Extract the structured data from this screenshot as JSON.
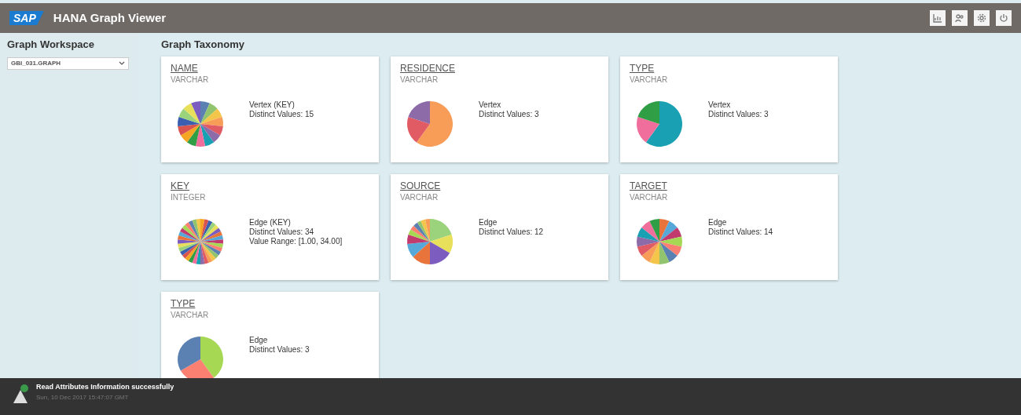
{
  "header": {
    "logo": "SAP",
    "title": "HANA Graph Viewer"
  },
  "sidebar": {
    "title": "Graph Workspace",
    "workspace_select": {
      "value": "GBI_031.GRAPH"
    }
  },
  "taxonomy": {
    "title": "Graph Taxonomy",
    "cards": [
      {
        "name": "NAME",
        "datatype": "VARCHAR",
        "lines": [
          "Vertex (KEY)",
          "Distinct Values: 15"
        ]
      },
      {
        "name": "RESIDENCE",
        "datatype": "VARCHAR",
        "lines": [
          "Vertex",
          "Distinct Values: 3"
        ]
      },
      {
        "name": "TYPE",
        "datatype": "VARCHAR",
        "lines": [
          "Vertex",
          "Distinct Values: 3"
        ]
      },
      {
        "name": "KEY",
        "datatype": "INTEGER",
        "lines": [
          "Edge (KEY)",
          "Distinct Values: 34",
          "Value Range: [1.00, 34.00]"
        ]
      },
      {
        "name": "SOURCE",
        "datatype": "VARCHAR",
        "lines": [
          "Edge",
          "Distinct Values: 12"
        ]
      },
      {
        "name": "TARGET",
        "datatype": "VARCHAR",
        "lines": [
          "Edge",
          "Distinct Values: 14"
        ]
      },
      {
        "name": "TYPE",
        "datatype": "VARCHAR",
        "lines": [
          "Edge",
          "Distinct Values: 3"
        ]
      }
    ]
  },
  "status_bar": {
    "message": "Read Attributes Information successfully",
    "timestamp": "Sun, 10 Dec 2017 15:47:07 GMT"
  }
}
